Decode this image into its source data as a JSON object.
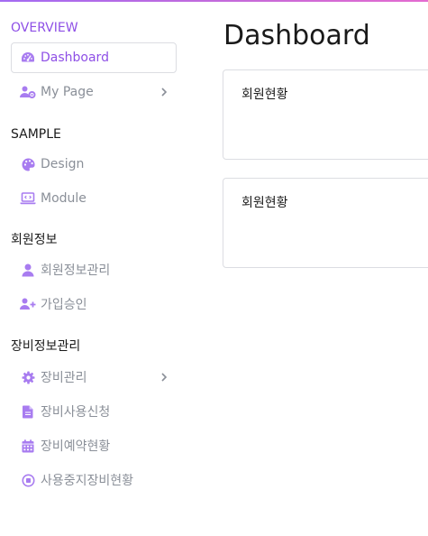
{
  "sidebar": {
    "sections": [
      {
        "title": "OVERVIEW",
        "items": [
          {
            "label": "Dashboard",
            "icon": "tachometer-icon",
            "active": true
          },
          {
            "label": "My Page",
            "icon": "user-gear-icon",
            "has_submenu": true
          }
        ]
      },
      {
        "title": "SAMPLE",
        "items": [
          {
            "label": "Design",
            "icon": "palette-icon"
          },
          {
            "label": "Module",
            "icon": "laptop-code-icon"
          }
        ]
      },
      {
        "title": "회원정보",
        "items": [
          {
            "label": "회원정보관리",
            "icon": "user-icon"
          },
          {
            "label": "가입승인",
            "icon": "user-plus-icon"
          }
        ]
      },
      {
        "title": "장비정보관리",
        "items": [
          {
            "label": "장비관리",
            "icon": "gear-icon",
            "has_submenu": true
          },
          {
            "label": "장비사용신청",
            "icon": "file-icon"
          },
          {
            "label": "장비예약현황",
            "icon": "calendar-icon"
          },
          {
            "label": "사용중지장비현황",
            "icon": "stop-circle-icon"
          }
        ]
      }
    ]
  },
  "main": {
    "title": "Dashboard",
    "cards": [
      {
        "title": "회원현황"
      },
      {
        "title": "회원현황"
      }
    ]
  },
  "colors": {
    "accent": "#8e4fe6",
    "icon": "#a87cf0",
    "muted_text": "#8a8f98",
    "border": "#dcdde2"
  }
}
